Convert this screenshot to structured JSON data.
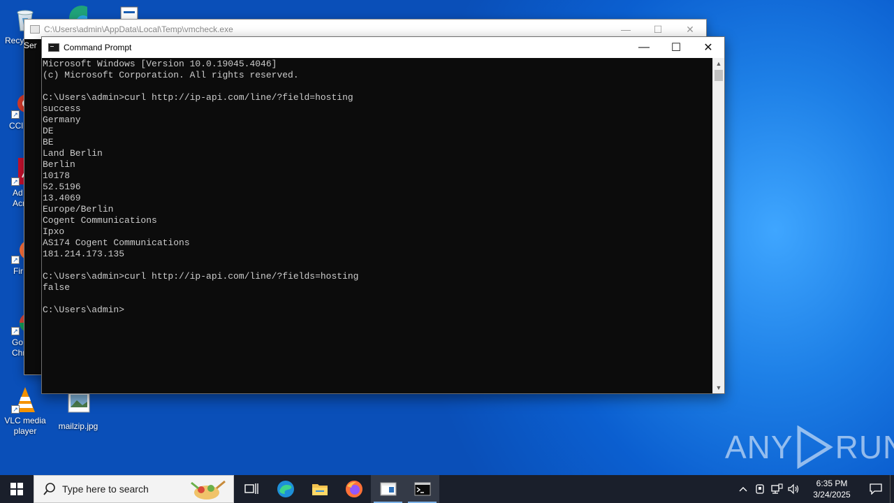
{
  "desktop": {
    "icons": [
      {
        "label": "Recy",
        "icon": "recycle-bin-icon"
      },
      {
        "label": "CCl",
        "icon": "ccleaner-icon"
      },
      {
        "label": "Ad\nAcr",
        "icon": "acrobat-icon"
      },
      {
        "label": "Fir",
        "icon": "firefox-icon"
      },
      {
        "label": "Go\nChr",
        "icon": "chrome-icon"
      },
      {
        "label": "VLC media\nplayer",
        "icon": "vlc-icon"
      },
      {
        "label": "mailzip.jpg",
        "icon": "image-file-icon"
      }
    ],
    "partial_label": "Ser"
  },
  "back_window": {
    "title": "C:\\Users\\admin\\AppData\\Local\\Temp\\vmcheck.exe",
    "minimize": "—",
    "maximize": "☐",
    "close": "✕"
  },
  "cmd_window": {
    "title": "Command Prompt",
    "minimize": "—",
    "maximize": "☐",
    "close": "✕",
    "lines": [
      "Microsoft Windows [Version 10.0.19045.4046]",
      "(c) Microsoft Corporation. All rights reserved.",
      "",
      "C:\\Users\\admin>curl http://ip-api.com/line/?field=hosting",
      "success",
      "Germany",
      "DE",
      "BE",
      "Land Berlin",
      "Berlin",
      "10178",
      "52.5196",
      "13.4069",
      "Europe/Berlin",
      "Cogent Communications",
      "Ipxo",
      "AS174 Cogent Communications",
      "181.214.173.135",
      "",
      "C:\\Users\\admin>curl http://ip-api.com/line/?fields=hosting",
      "false",
      "",
      "C:\\Users\\admin>"
    ]
  },
  "watermark": {
    "left": "ANY",
    "right": "RUN"
  },
  "taskbar": {
    "search_placeholder": "Type here to search",
    "apps": [
      "task-view-icon",
      "edge-icon",
      "file-explorer-icon",
      "firefox-icon",
      "vmcheck-icon",
      "cmd-icon"
    ],
    "clock_time": "6:35 PM",
    "clock_date": "3/24/2025"
  },
  "colors": {
    "console_bg": "#0c0c0c",
    "console_fg": "#cccccc",
    "taskbar_bg": "#1a1f2b"
  }
}
